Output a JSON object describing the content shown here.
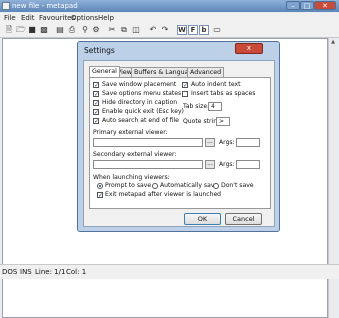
{
  "window": {
    "title": "new file - metapad"
  },
  "menu": [
    "File",
    "Edit",
    "Favourites",
    "Options",
    "Help"
  ],
  "toolbar": {
    "icons": [
      "new-file-icon",
      "open-folder-icon",
      "save-icon",
      "save-as-icon",
      "print-preview-icon",
      "print-icon",
      "find-icon",
      "settings-icon",
      "cut-icon",
      "copy-icon",
      "paste-icon",
      "undo-icon",
      "redo-icon",
      "word-wrap-icon",
      "font-icon",
      "primary-viewer-icon",
      "always-on-top-icon"
    ],
    "boxed": [
      "W",
      "F",
      "b"
    ]
  },
  "status": {
    "mode": "DOS",
    "ins": "INS",
    "line": "Line: 1/1",
    "col": "Col: 1"
  },
  "dialog": {
    "title": "Settings",
    "close": "x",
    "tabs": [
      "General",
      "View",
      "Buffers & Language",
      "Advanced"
    ],
    "active_tab": "General",
    "checkboxes": [
      {
        "label": "Save window placement",
        "checked": true
      },
      {
        "label": "Save options menu states",
        "checked": true
      },
      {
        "label": "Hide directory in caption",
        "checked": true
      },
      {
        "label": "Enable quick exit (Esc key)",
        "checked": true
      },
      {
        "label": "Auto search at end of file",
        "checked": true
      },
      {
        "label": "Auto indent text",
        "checked": true
      },
      {
        "label": "Insert tabs as spaces",
        "checked": false
      }
    ],
    "tab_size_label": "Tab size:",
    "tab_size_value": "4",
    "quote_label": "Quote string:",
    "quote_value": ">",
    "primary_label": "Primary external viewer:",
    "secondary_label": "Secondary external viewer:",
    "args_label": "Args:",
    "browse": "...",
    "launch_label": "When launching viewers:",
    "radios": [
      {
        "label": "Prompt to save",
        "selected": true
      },
      {
        "label": "Automatically save",
        "selected": false
      },
      {
        "label": "Don't save",
        "selected": false
      }
    ],
    "exit_label": "Exit metapad after viewer is launched",
    "exit_checked": true,
    "ok": "OK",
    "cancel": "Cancel"
  }
}
